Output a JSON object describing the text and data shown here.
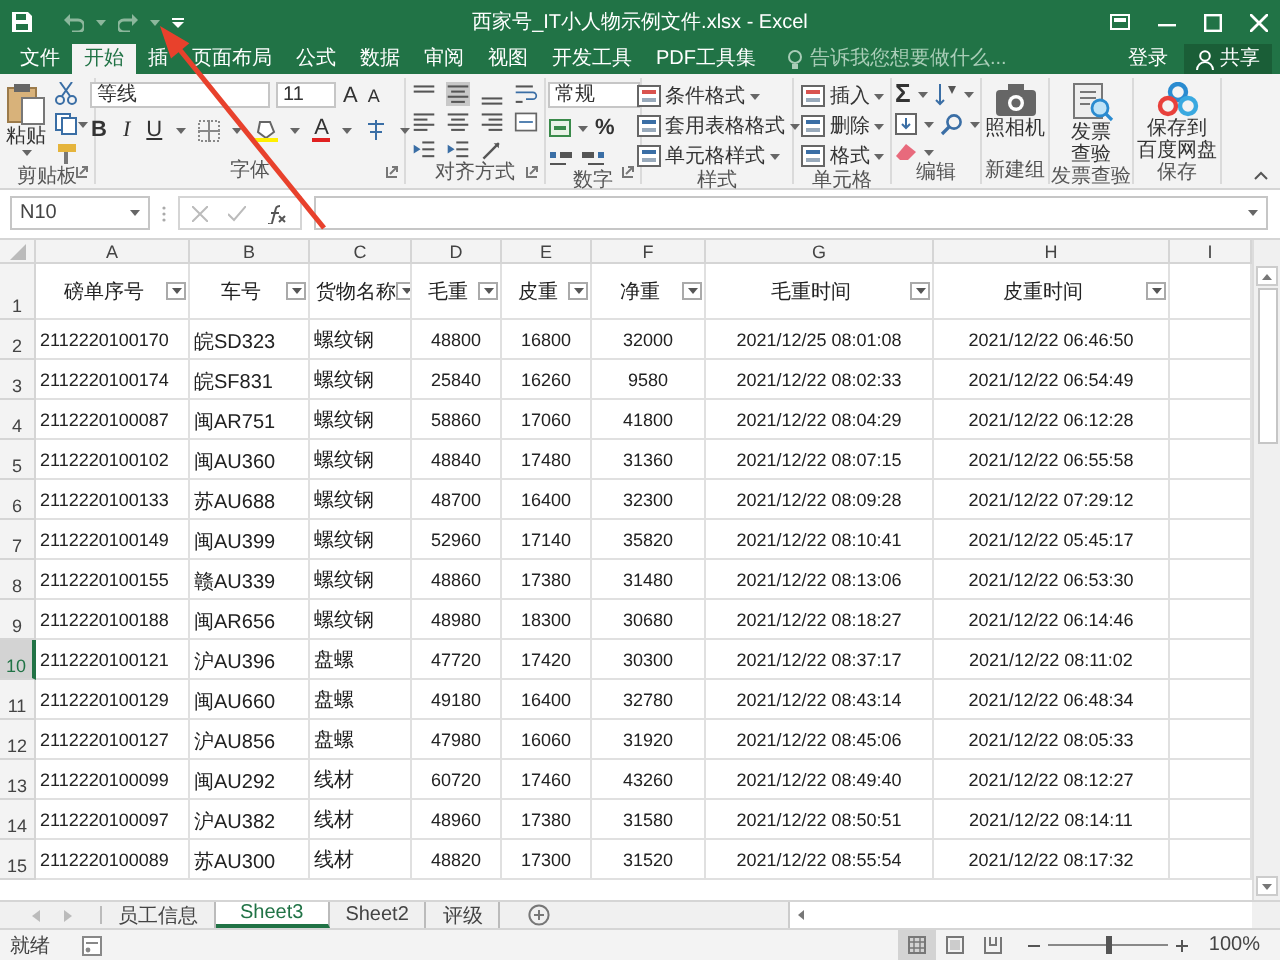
{
  "window": {
    "title": "西家号_IT小人物示例文件.xlsx - Excel"
  },
  "ribbon_tabs": [
    {
      "label": "文件",
      "selected": false
    },
    {
      "label": "开始",
      "selected": true
    },
    {
      "label": "插",
      "selected": false
    },
    {
      "label": "页面布局",
      "selected": false
    },
    {
      "label": "公式",
      "selected": false
    },
    {
      "label": "数据",
      "selected": false
    },
    {
      "label": "审阅",
      "selected": false
    },
    {
      "label": "视图",
      "selected": false
    },
    {
      "label": "开发工具",
      "selected": false
    },
    {
      "label": "PDF工具集",
      "selected": false
    }
  ],
  "tell_me": {
    "placeholder": "告诉我您想要做什么..."
  },
  "account": {
    "sign_in": "登录",
    "share": "共享"
  },
  "ribbon": {
    "groups": [
      {
        "kind": "clipboard",
        "label": "剪贴板",
        "paste": "粘贴"
      },
      {
        "kind": "font",
        "label": "字体",
        "font_name": "等线",
        "font_size": "11",
        "grow": "A",
        "shrink": "A",
        "bold": "B",
        "italic": "I",
        "underline": "U",
        "font_color": "A"
      },
      {
        "kind": "alignment",
        "label": "对齐方式"
      },
      {
        "kind": "number",
        "label": "数字",
        "format": "常规",
        "percent": "%"
      },
      {
        "kind": "list",
        "label": "样式",
        "items": [
          "条件格式",
          "套用表格格式",
          "单元格样式"
        ]
      },
      {
        "kind": "list",
        "label": "单元格",
        "items": [
          "插入",
          "删除",
          "格式"
        ]
      },
      {
        "kind": "editing",
        "label": "编辑",
        "sum": "Σ"
      },
      {
        "kind": "camera",
        "label": "新建组",
        "lines": [
          "照相机"
        ]
      },
      {
        "kind": "invoice",
        "label": "发票查验",
        "lines": [
          "发票",
          "查验"
        ]
      },
      {
        "kind": "cloud",
        "label": "保存",
        "lines": [
          "保存到",
          "百度网盘"
        ]
      }
    ]
  },
  "formula_bar": {
    "name_box": "N10"
  },
  "sheet": {
    "columns": [
      "A",
      "B",
      "C",
      "D",
      "E",
      "F",
      "G",
      "H",
      "I"
    ],
    "header": {
      "row": "1",
      "cells": [
        "磅单序号",
        "车号",
        "货物名称",
        "毛重",
        "皮重",
        "净重",
        "毛重时间",
        "皮重时间"
      ]
    },
    "rows": [
      {
        "row": "2",
        "selected": false,
        "cells": [
          "2112220100170",
          "皖SD323",
          "螺纹钢",
          "48800",
          "16800",
          "32000",
          "2021/12/25 08:01:08",
          "2021/12/22 06:46:50"
        ]
      },
      {
        "row": "3",
        "selected": false,
        "cells": [
          "2112220100174",
          "皖SF831",
          "螺纹钢",
          "25840",
          "16260",
          "9580",
          "2021/12/22 08:02:33",
          "2021/12/22 06:54:49"
        ]
      },
      {
        "row": "4",
        "selected": false,
        "cells": [
          "2112220100087",
          "闽AR751",
          "螺纹钢",
          "58860",
          "17060",
          "41800",
          "2021/12/22 08:04:29",
          "2021/12/22 06:12:28"
        ]
      },
      {
        "row": "5",
        "selected": false,
        "cells": [
          "2112220100102",
          "闽AU360",
          "螺纹钢",
          "48840",
          "17480",
          "31360",
          "2021/12/22 08:07:15",
          "2021/12/22 06:55:58"
        ]
      },
      {
        "row": "6",
        "selected": false,
        "cells": [
          "2112220100133",
          "苏AU688",
          "螺纹钢",
          "48700",
          "16400",
          "32300",
          "2021/12/22 08:09:28",
          "2021/12/22 07:29:12"
        ]
      },
      {
        "row": "7",
        "selected": false,
        "cells": [
          "2112220100149",
          "闽AU399",
          "螺纹钢",
          "52960",
          "17140",
          "35820",
          "2021/12/22 08:10:41",
          "2021/12/22 05:45:17"
        ]
      },
      {
        "row": "8",
        "selected": false,
        "cells": [
          "2112220100155",
          "赣AU339",
          "螺纹钢",
          "48860",
          "17380",
          "31480",
          "2021/12/22 08:13:06",
          "2021/12/22 06:53:30"
        ]
      },
      {
        "row": "9",
        "selected": false,
        "cells": [
          "2112220100188",
          "闽AR656",
          "螺纹钢",
          "48980",
          "18300",
          "30680",
          "2021/12/22 08:18:27",
          "2021/12/22 06:14:46"
        ]
      },
      {
        "row": "10",
        "selected": true,
        "cells": [
          "2112220100121",
          "沪AU396",
          "盘螺",
          "47720",
          "17420",
          "30300",
          "2021/12/22 08:37:17",
          "2021/12/22 08:11:02"
        ]
      },
      {
        "row": "11",
        "selected": false,
        "cells": [
          "2112220100129",
          "闽AU660",
          "盘螺",
          "49180",
          "16400",
          "32780",
          "2021/12/22 08:43:14",
          "2021/12/22 06:48:34"
        ]
      },
      {
        "row": "12",
        "selected": false,
        "cells": [
          "2112220100127",
          "沪AU856",
          "盘螺",
          "47980",
          "16060",
          "31920",
          "2021/12/22 08:45:06",
          "2021/12/22 08:05:33"
        ]
      },
      {
        "row": "13",
        "selected": false,
        "cells": [
          "2112220100099",
          "闽AU292",
          "线材",
          "60720",
          "17460",
          "43260",
          "2021/12/22 08:49:40",
          "2021/12/22 08:12:27"
        ]
      },
      {
        "row": "14",
        "selected": false,
        "cells": [
          "2112220100097",
          "沪AU382",
          "线材",
          "48960",
          "17380",
          "31580",
          "2021/12/22 08:50:51",
          "2021/12/22 08:14:11"
        ]
      },
      {
        "row": "15",
        "selected": false,
        "cells": [
          "2112220100089",
          "苏AU300",
          "线材",
          "48820",
          "17300",
          "31520",
          "2021/12/22 08:55:54",
          "2021/12/22 08:17:32"
        ]
      }
    ]
  },
  "sheet_tabs": [
    {
      "label": "员工信息",
      "selected": false
    },
    {
      "label": "Sheet3",
      "selected": true
    },
    {
      "label": "Sheet2",
      "selected": false
    },
    {
      "label": "评级",
      "selected": false
    }
  ],
  "status_bar": {
    "text": "就绪",
    "zoom": "100%",
    "zoom_slider": {
      "level": 0.5
    }
  }
}
